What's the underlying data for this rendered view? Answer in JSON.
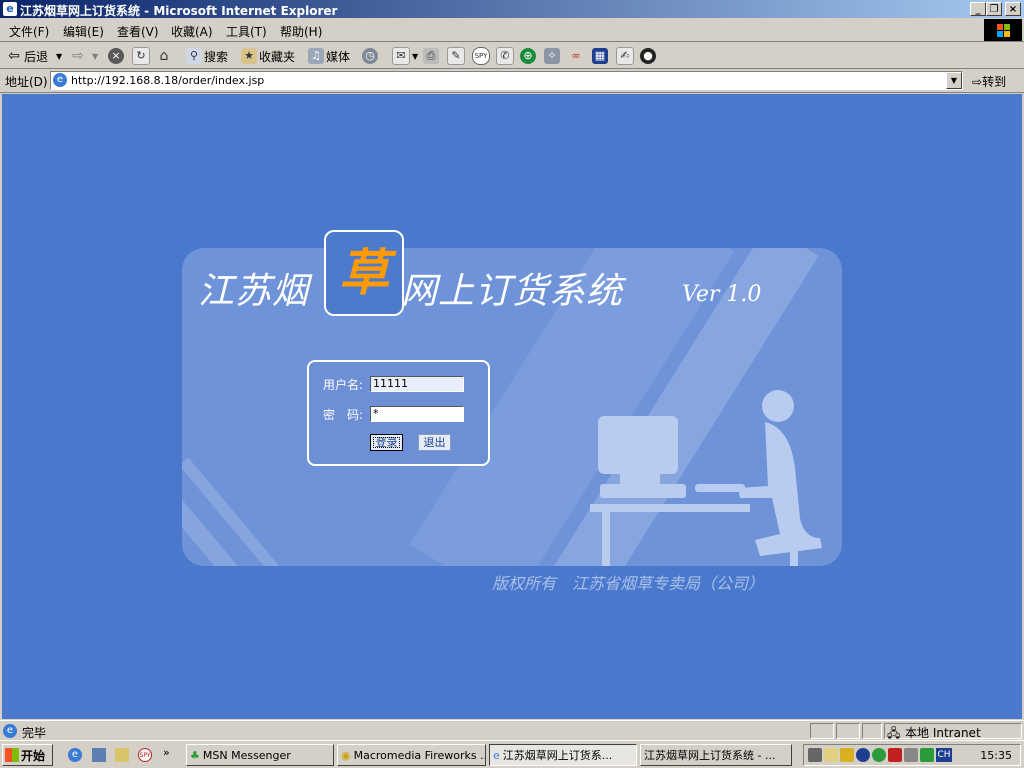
{
  "window": {
    "title": "江苏烟草网上订货系统 - Microsoft Internet Explorer",
    "minimize": "_",
    "maximize": "❐",
    "close": "×"
  },
  "menu": [
    "文件(F)",
    "编辑(E)",
    "查看(V)",
    "收藏(A)",
    "工具(T)",
    "帮助(H)"
  ],
  "toolbar": {
    "back": "后退",
    "search": "搜索",
    "favorites": "收藏夹",
    "media": "媒体"
  },
  "address": {
    "label": "地址(D)",
    "url": "http://192.168.8.18/order/index.jsp",
    "go": "转到"
  },
  "page": {
    "title_left": "江苏烟",
    "title_logo": "草",
    "title_right": "网上订货系统",
    "version": "Ver 1.0",
    "username_label": "用户名:",
    "username_value": "11111",
    "password_label": "密　码:",
    "password_value": "*",
    "login_button": "登录",
    "exit_button": "退出",
    "copyright": "版权所有　江苏省烟草专卖局（公司）"
  },
  "status": {
    "text": "完毕",
    "zone": "本地 Intranet"
  },
  "taskbar": {
    "start": "开始",
    "tasks": [
      "MSN Messenger",
      "Macromedia Fireworks ...",
      "江苏烟草网上订货系...",
      "江苏烟草网上订货系统 - ..."
    ],
    "lang": "CH",
    "clock": "15:35"
  },
  "colors": {
    "page_bg": "#4a78cc",
    "panel_bg": "#6f93d8",
    "logo_text": "#ff9a00"
  }
}
